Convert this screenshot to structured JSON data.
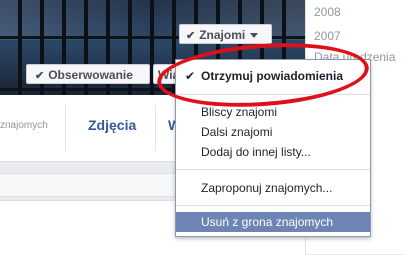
{
  "timeline": {
    "years": [
      "2008",
      "2007",
      "Data urodzenia"
    ]
  },
  "profile_nav": {
    "friends_fragment": "znajomych",
    "photos_tab": "Zdjęcia",
    "more_tab_fragment": "W"
  },
  "cover_buttons": {
    "follow_label": "Obserwowanie",
    "message_fragment": "Wia",
    "friends_label": "Znajomi"
  },
  "friend_menu": {
    "items": [
      {
        "label": "Otrzymuj powiadomienia",
        "checked": true
      },
      {
        "label": "Bliscy znajomi"
      },
      {
        "label": "Dalsi znajomi"
      },
      {
        "label": "Dodaj do innej listy..."
      },
      {
        "label": "Zaproponuj znajomych..."
      },
      {
        "label": "Usuń z grona znajomych",
        "highlighted": true
      }
    ]
  },
  "colors": {
    "annotation": "#e0101b",
    "link": "#365899",
    "highlight": "#6d84b4"
  },
  "icons": [
    "check-icon",
    "dropdown-caret-icon"
  ]
}
